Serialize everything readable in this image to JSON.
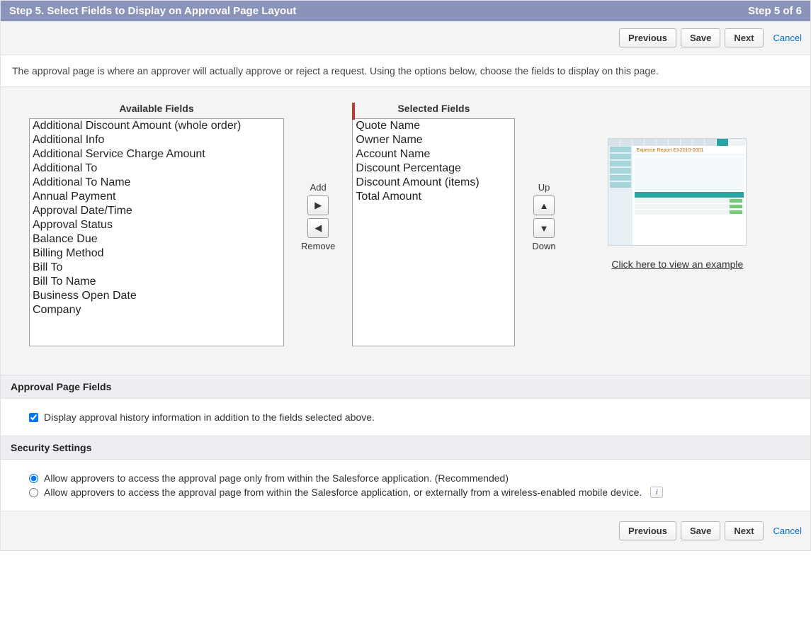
{
  "step": {
    "title": "Step 5. Select Fields to Display on Approval Page Layout",
    "counter": "Step 5 of 6"
  },
  "buttons": {
    "previous": "Previous",
    "save": "Save",
    "next": "Next",
    "cancel": "Cancel"
  },
  "intro": "The approval page is where an approver will actually approve or reject a request. Using the options below, choose the fields to display on this page.",
  "picker": {
    "available_label": "Available Fields",
    "selected_label": "Selected Fields",
    "add_label": "Add",
    "remove_label": "Remove",
    "up_label": "Up",
    "down_label": "Down",
    "available": [
      "Additional Discount Amount (whole order)",
      "Additional Info",
      "Additional Service Charge Amount",
      "Additional To",
      "Additional To Name",
      "Annual Payment",
      "Approval Date/Time",
      "Approval Status",
      "Balance Due",
      "Billing Method",
      "Bill To",
      "Bill To Name",
      "Business Open Date",
      "Company"
    ],
    "selected": [
      "Quote Name",
      "Owner Name",
      "Account Name",
      "Discount Percentage",
      "Discount Amount (items)",
      "Total Amount"
    ]
  },
  "example_link": "Click here to view an example",
  "sections": {
    "approval_fields": {
      "header": "Approval Page Fields",
      "checkbox_label": "Display approval history information in addition to the fields selected above.",
      "checked": true
    },
    "security": {
      "header": "Security Settings",
      "option1": "Allow approvers to access the approval page only from within the Salesforce application. (Recommended)",
      "option2": "Allow approvers to access the approval page from within the Salesforce application, or externally from a wireless-enabled mobile device.",
      "selected": "option1"
    }
  }
}
